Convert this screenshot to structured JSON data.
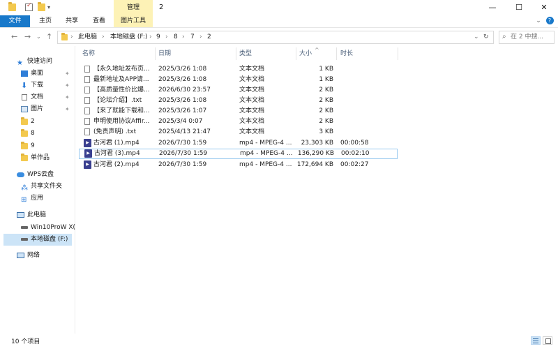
{
  "window": {
    "title": "2",
    "manage_tab": "管理",
    "minimize": "—",
    "maximize": "☐",
    "close": "✕",
    "help": "?"
  },
  "ribbon": {
    "tabs": [
      "文件",
      "主页",
      "共享",
      "查看",
      "图片工具"
    ]
  },
  "address": {
    "crumbs": [
      "此电脑",
      "本地磁盘 (F:)",
      "9",
      "8",
      "7",
      "2"
    ],
    "search_placeholder": "在 2 中搜..."
  },
  "nav": {
    "items": [
      {
        "label": "快速访问",
        "icon": "star-icon",
        "pinned": false
      },
      {
        "label": "桌面",
        "icon": "desktop-icon",
        "pinned": true
      },
      {
        "label": "下载",
        "icon": "download-icon",
        "pinned": true
      },
      {
        "label": "文档",
        "icon": "document-icon",
        "pinned": true
      },
      {
        "label": "图片",
        "icon": "picture-icon",
        "pinned": true
      },
      {
        "label": "2",
        "icon": "folder-icon",
        "pinned": false
      },
      {
        "label": "8",
        "icon": "folder-icon",
        "pinned": false
      },
      {
        "label": "9",
        "icon": "folder-icon",
        "pinned": false
      },
      {
        "label": "单作品",
        "icon": "folder-icon",
        "pinned": false
      },
      {
        "label": "WPS云盘",
        "icon": "cloud-icon",
        "pinned": false
      },
      {
        "label": "共享文件夹",
        "icon": "share-icon",
        "pinned": false
      },
      {
        "label": "应用",
        "icon": "apps-icon",
        "pinned": false
      },
      {
        "label": "此电脑",
        "icon": "pc-icon",
        "pinned": false
      },
      {
        "label": "Win10ProW X(",
        "icon": "drive-icon",
        "pinned": false
      },
      {
        "label": "本地磁盘 (F:)",
        "icon": "drive-icon",
        "pinned": false
      },
      {
        "label": "网络",
        "icon": "network-icon",
        "pinned": false
      }
    ]
  },
  "columns": [
    "名称",
    "日期",
    "类型",
    "大小",
    "时长"
  ],
  "files": [
    {
      "name": "【永久地址发布页...",
      "date": "2025/3/26 1:08",
      "type": "文本文档",
      "size": "1 KB",
      "duration": "",
      "kind": "txt"
    },
    {
      "name": "最新地址及APP请...",
      "date": "2025/3/26 1:08",
      "type": "文本文档",
      "size": "1 KB",
      "duration": "",
      "kind": "txt"
    },
    {
      "name": "【高质量性价比爆...",
      "date": "2026/6/30 23:57",
      "type": "文本文档",
      "size": "2 KB",
      "duration": "",
      "kind": "txt"
    },
    {
      "name": "【论坛介绍】.txt",
      "date": "2025/3/26 1:08",
      "type": "文本文档",
      "size": "2 KB",
      "duration": "",
      "kind": "txt"
    },
    {
      "name": "【来了就能下载和...",
      "date": "2025/3/26 1:07",
      "type": "文本文档",
      "size": "2 KB",
      "duration": "",
      "kind": "txt"
    },
    {
      "name": "申明使用协议Affir...",
      "date": "2025/3/4 0:07",
      "type": "文本文档",
      "size": "2 KB",
      "duration": "",
      "kind": "txt"
    },
    {
      "name": "(免责声明) .txt",
      "date": "2025/4/13 21:47",
      "type": "文本文档",
      "size": "3 KB",
      "duration": "",
      "kind": "txt"
    },
    {
      "name": "古河君 (1).mp4",
      "date": "2026/7/30 1:59",
      "type": "mp4 - MPEG-4 ...",
      "size": "23,303 KB",
      "duration": "00:00:58",
      "kind": "mp4"
    },
    {
      "name": "古河君 (3).mp4",
      "date": "2026/7/30 1:59",
      "type": "mp4 - MPEG-4 ...",
      "size": "136,290 KB",
      "duration": "00:02:10",
      "kind": "mp4"
    },
    {
      "name": "古河君 (2).mp4",
      "date": "2026/7/30 1:59",
      "type": "mp4 - MPEG-4 ...",
      "size": "172,694 KB",
      "duration": "00:02:27",
      "kind": "mp4"
    }
  ],
  "status": {
    "count_text": "10 个项目"
  },
  "colors": {
    "accent": "#1979ca",
    "manage_tab": "#fdf2b6",
    "selection_border": "#99c9ef",
    "folder": "#f3c94e"
  }
}
